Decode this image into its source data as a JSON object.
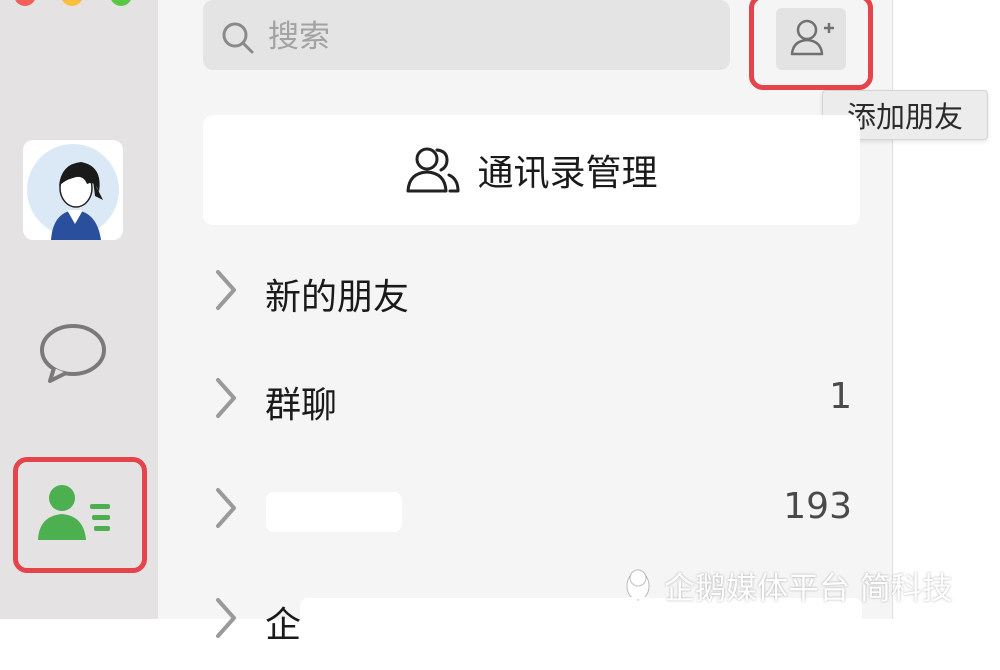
{
  "search": {
    "placeholder": "搜索"
  },
  "add_friend": {
    "icon": "add-user-icon",
    "tooltip": "添加朋友"
  },
  "contacts_manager": {
    "icon": "contacts-icon",
    "label": "通讯录管理"
  },
  "list": [
    {
      "label": "新的朋友",
      "count": ""
    },
    {
      "label": "群聊",
      "count": "1"
    },
    {
      "label": "",
      "count": "193"
    },
    {
      "label": "企",
      "count": ""
    }
  ],
  "watermark": {
    "text": "企鹅媒体平台 简科技"
  },
  "colors": {
    "accent_green": "#4caf50",
    "highlight_red": "#e5454a"
  }
}
